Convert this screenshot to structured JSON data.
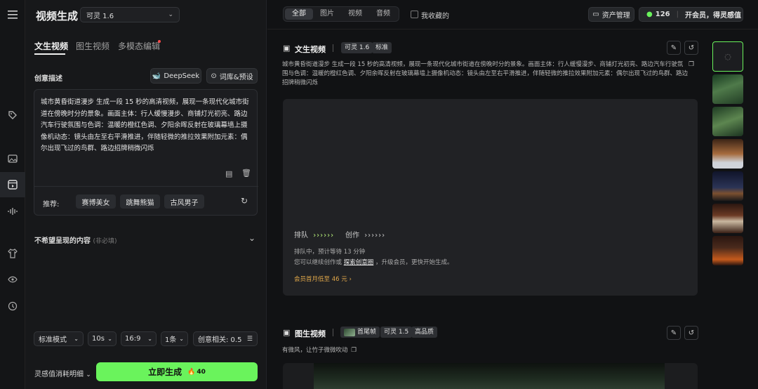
{
  "rail": {
    "icons": [
      "menu-icon",
      "tag-icon",
      "image-icon",
      "video-icon",
      "audio-icon",
      "shirt-icon",
      "eye-icon",
      "history-icon"
    ]
  },
  "panel": {
    "title": "视频生成",
    "model_select": "可灵 1.6",
    "tabs": [
      {
        "label": "文生视频",
        "active": true
      },
      {
        "label": "图生视频",
        "active": false
      },
      {
        "label": "多模态编辑",
        "active": false
      }
    ],
    "creative_label": "创意描述",
    "deepseek_label": "DeepSeek",
    "dict_label": "词库&预设",
    "prompt_text": "城市黄昏街道漫步 生成一段 15 秒的高清视频，展现一条现代化城市街道在傍晚时分的景象。画面主体：行人缓慢漫步、商铺灯光初亮、路边汽车行驶氛围与色调：温暖的橙红色调、夕阳余晖反射在玻璃幕墙上摄像机动态：镜头由左至右平滑推进，伴随轻微的推拉效果附加元素：偶尔出现飞过的鸟群、路边招牌稍微闪烁",
    "recommend_label": "推荐:",
    "recommend_chips": [
      "赛博美女",
      "跳舞熊猫",
      "古风男子"
    ],
    "negative_label": "不希望呈现的内容",
    "negative_hint": "(非必填)",
    "options": {
      "mode": "标准模式",
      "duration": "10s",
      "ratio": "16:9",
      "count": "1条",
      "relevance": "创意相关: 0.5"
    },
    "cost_label": "灵感值消耗明细",
    "generate_label": "立即生成",
    "generate_cost": "40"
  },
  "topbar": {
    "filters": [
      {
        "label": "全部",
        "active": true
      },
      {
        "label": "图片",
        "active": false
      },
      {
        "label": "视频",
        "active": false
      },
      {
        "label": "音频",
        "active": false
      }
    ],
    "favorites_label": "我收藏的",
    "assets_label": "资产管理",
    "points": "126",
    "vip_label": "开会员，得灵感值"
  },
  "cards": [
    {
      "type_label": "文生视频",
      "badges": [
        "可灵 1.6",
        "标准"
      ],
      "prompt": "城市黄昏街道漫步 生成一段 15 秒的高清视频，展现一条现代化城市街道在傍晚时分的景象。画面主体：行人缓慢漫步、商铺灯光初亮、路边汽车行驶氛围与色调：温暖的橙红色调、夕阳余晖反射在玻璃幕墙上摄像机动态：镜头由左至右平滑推进，伴随轻微的推拉效果附加元素：偶尔出现飞过的鸟群、路边招牌稍微闪烁",
      "queue_label": "排队",
      "queue_arrows": "››››››",
      "create_label": "创作",
      "create_arrows": "››››››",
      "status": "排队中，预计等待 13 分钟",
      "hint_prefix": "您可以继续创作或",
      "hint_link": "探索创意圈",
      "hint_suffix": "，升级会员，更快开始生成。",
      "vip_offer": "会员首月低至 46 元"
    },
    {
      "type_label": "图生视频",
      "badges": [
        "首尾帧",
        "可灵 1.5",
        "高品质"
      ],
      "prompt": "有微风，让竹子微微吹动"
    }
  ],
  "colors": {
    "accent_green": "#6af35c",
    "background": "#111214"
  }
}
